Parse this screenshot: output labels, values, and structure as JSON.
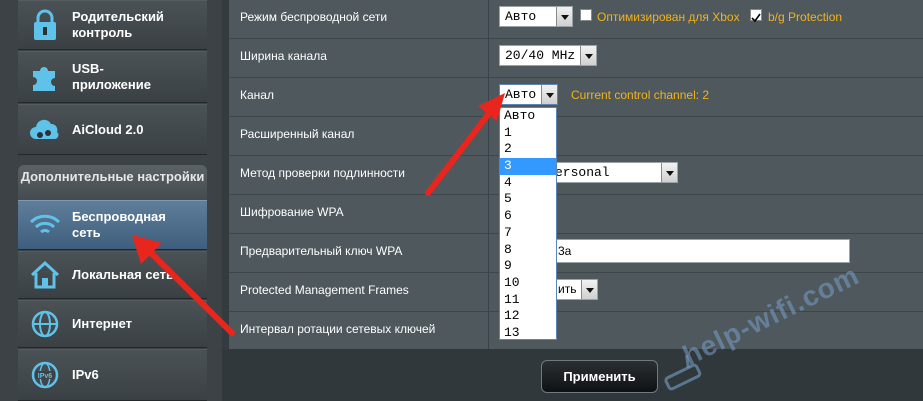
{
  "sidebar": {
    "section_title": "Дополнительные настройки",
    "items_top": [
      {
        "label": "Родительский контроль",
        "icon": "lock-icon"
      },
      {
        "label": "USB-приложение",
        "icon": "puzzle-icon"
      },
      {
        "label": "AiCloud 2.0",
        "icon": "cloud-icon"
      }
    ],
    "items": [
      {
        "label": "Беспроводная сеть",
        "icon": "wifi-icon",
        "active": true
      },
      {
        "label": "Локальная сеть",
        "icon": "house-icon"
      },
      {
        "label": "Интернет",
        "icon": "globe-icon"
      },
      {
        "label": "IPv6",
        "icon": "ipv6-globe-icon"
      }
    ]
  },
  "form": {
    "wireless_mode": {
      "label": "Режим беспроводной сети",
      "value": "Авто",
      "xbox_label": "Оптимизирован для Xbox",
      "xbox_checked": false,
      "bg_label": "b/g Protection",
      "bg_checked": true
    },
    "channel_width": {
      "label": "Ширина канала",
      "value": "20/40 MHz"
    },
    "channel": {
      "label": "Канал",
      "value": "Авто",
      "status": "Current control channel: 2"
    },
    "ext_channel": {
      "label": "Расширенный канал"
    },
    "auth_method": {
      "label": "Метод проверки подлинности",
      "value_partial": "ersonal"
    },
    "wpa_encryption": {
      "label": "Шифрование WPA"
    },
    "wpa_key": {
      "label": "Предварительный ключ WPA",
      "value_partial": "3a"
    },
    "pmf": {
      "label": "Protected Management Frames",
      "value_partial": "ить"
    },
    "key_rotation": {
      "label": "Интервал ротации сетевых ключей"
    }
  },
  "channel_dropdown": {
    "options": [
      "Авто",
      "1",
      "2",
      "3",
      "4",
      "5",
      "6",
      "7",
      "8",
      "9",
      "10",
      "11",
      "12",
      "13"
    ],
    "highlighted_index": 3
  },
  "apply_label": "Применить",
  "watermark": "help-wifi.com",
  "colors": {
    "accent_yellow": "#f2b31a",
    "annotation_red": "#e8261d",
    "active_nav": "#4b6b8a"
  }
}
